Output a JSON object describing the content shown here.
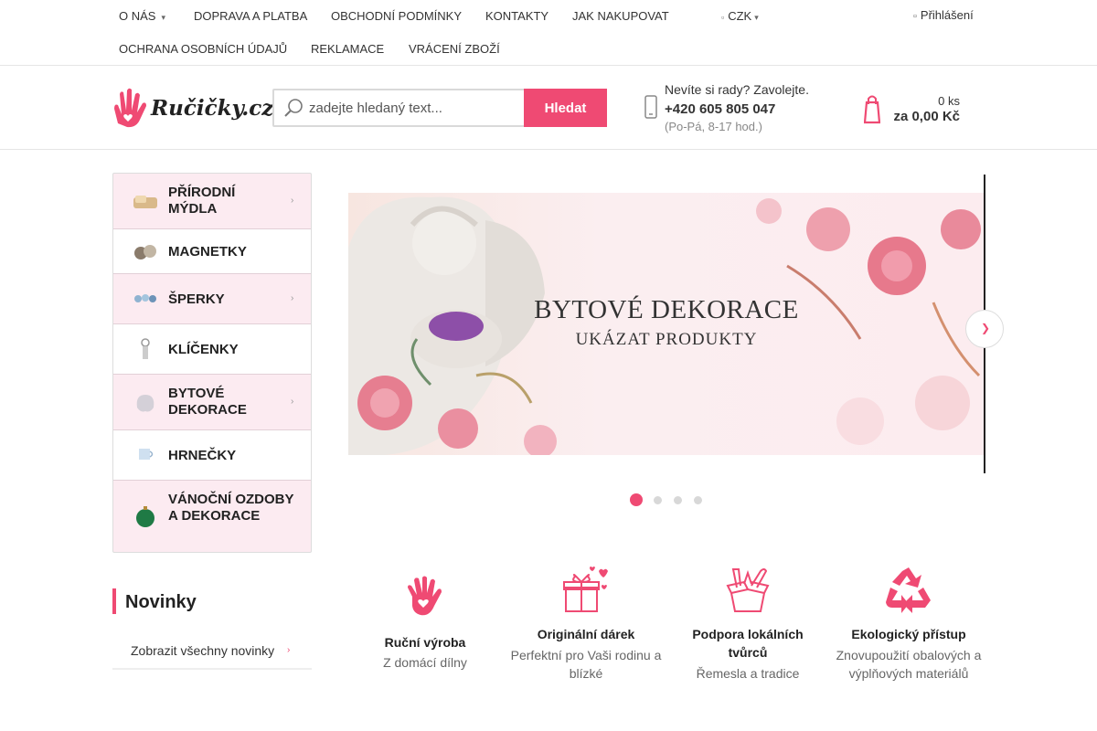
{
  "topnav": {
    "items": [
      {
        "label": "O nás",
        "has_submenu": true
      },
      {
        "label": "Doprava a platba"
      },
      {
        "label": "Obchodní podmínky"
      },
      {
        "label": "Kontakty"
      },
      {
        "label": "Jak nakupovat"
      },
      {
        "label": "CZK",
        "has_submenu": true
      },
      {
        "label": "Ochrana osobních údajů"
      },
      {
        "label": "Reklamace"
      },
      {
        "label": "Vrácení zboží"
      }
    ],
    "login": "Přihlášení"
  },
  "header": {
    "logo_text": "Ručičky.cz",
    "search": {
      "placeholder": "zadejte hledaný text...",
      "button": "Hledat"
    },
    "phone": {
      "question": "Nevíte si rady? Zavolejte.",
      "number": "+420 605 805 047",
      "hours": "(Po-Pá, 8-17 hod.)"
    },
    "cart": {
      "quantity": "0 ks",
      "price": "za 0,00 Kč"
    }
  },
  "categories": [
    {
      "label": "Přírodní mýdla",
      "has_sub": true
    },
    {
      "label": "Magnetky",
      "has_sub": false
    },
    {
      "label": "Šperky",
      "has_sub": true
    },
    {
      "label": "Klíčenky",
      "has_sub": false
    },
    {
      "label": "Bytové dekorace",
      "has_sub": true
    },
    {
      "label": "Hrnečky",
      "has_sub": false
    },
    {
      "label": "Vánoční ozdoby a dekorace",
      "has_sub": false
    }
  ],
  "novinky": {
    "title": "Novinky",
    "link": "Zobrazit všechny novinky"
  },
  "banner": {
    "title": "BYTOVÉ DEKORACE",
    "subtitle": "UKÁZAT PRODUKTY",
    "slide_count": 4,
    "active_slide": 1
  },
  "features": [
    {
      "icon": "hand-heart-icon",
      "title": "Ruční výroba",
      "desc": "Z domácí dílny"
    },
    {
      "icon": "gift-icon",
      "title": "Originální dárek",
      "desc": "Perfektní pro Vaši rodinu a blízké"
    },
    {
      "icon": "craft-tools-icon",
      "title": "Podpora lokálních tvůrců",
      "desc": "Řemesla a tradice"
    },
    {
      "icon": "recycle-icon",
      "title": "Ekologický přístup",
      "desc": "Znovupoužití obalových a výplňových materiálů"
    }
  ],
  "colors": {
    "accent": "#ef4a73",
    "sidebar_bg": "#fcebf1"
  }
}
